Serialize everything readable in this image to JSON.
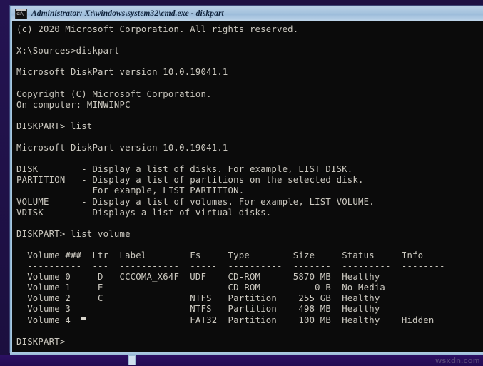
{
  "window": {
    "title": "Administrator: X:\\windows\\system32\\cmd.exe - diskpart",
    "icon": "cmd-icon",
    "colors": {
      "titlebar_top": "#b7cfe6",
      "titlebar_bottom": "#bdd4e9",
      "titlebar_text": "#10233c",
      "console_bg": "#0b0b0b",
      "console_fg": "#ccc9c0",
      "frame": "#8fb6d4",
      "desktop_bg": "#1a0f3d",
      "taskbar_bg": "#2c1063"
    }
  },
  "console": {
    "lines": [
      "(c) 2020 Microsoft Corporation. All rights reserved.",
      "",
      "X:\\Sources>diskpart",
      "",
      "Microsoft DiskPart version 10.0.19041.1",
      "",
      "Copyright (C) Microsoft Corporation.",
      "On computer: MINWINPC",
      "",
      "DISKPART> list",
      "",
      "Microsoft DiskPart version 10.0.19041.1",
      "",
      "DISK        - Display a list of disks. For example, LIST DISK.",
      "PARTITION   - Display a list of partitions on the selected disk.",
      "              For example, LIST PARTITION.",
      "VOLUME      - Display a list of volumes. For example, LIST VOLUME.",
      "VDISK       - Displays a list of virtual disks.",
      "",
      "DISKPART> list volume",
      "",
      "  Volume ###  Ltr  Label        Fs     Type        Size     Status     Info",
      "  ----------  ---  -----------  -----  ----------  -------  ---------  --------",
      "  Volume 0     D   CCCOMA_X64F  UDF    CD-ROM      5870 MB  Healthy",
      "  Volume 1     E                       CD-ROM          0 B  No Media",
      "  Volume 2     C                NTFS   Partition    255 GB  Healthy",
      "  Volume 3                      NTFS   Partition    498 MB  Healthy",
      "  Volume 4                      FAT32  Partition    100 MB  Healthy    Hidden",
      "",
      "DISKPART>"
    ],
    "prompt": "DISKPART>",
    "cursor": "block-cursor",
    "commands_entered": [
      "diskpart",
      "list",
      "list volume"
    ],
    "diskpart_version": "10.0.19041.1",
    "computer_name": "MINWINPC",
    "copyright": "Copyright (C) Microsoft Corporation.",
    "help_entries": [
      {
        "command": "DISK",
        "description": "Display a list of disks. For example, LIST DISK."
      },
      {
        "command": "PARTITION",
        "description": "Display a list of partitions on the selected disk. For example, LIST PARTITION."
      },
      {
        "command": "VOLUME",
        "description": "Display a list of volumes. For example, LIST VOLUME."
      },
      {
        "command": "VDISK",
        "description": "Displays a list of virtual disks."
      }
    ],
    "volume_table": {
      "headers": [
        "Volume ###",
        "Ltr",
        "Label",
        "Fs",
        "Type",
        "Size",
        "Status",
        "Info"
      ],
      "rows": [
        {
          "volume": "Volume 0",
          "ltr": "D",
          "label": "CCCOMA_X64F",
          "fs": "UDF",
          "type": "CD-ROM",
          "size": "5870 MB",
          "status": "Healthy",
          "info": ""
        },
        {
          "volume": "Volume 1",
          "ltr": "E",
          "label": "",
          "fs": "",
          "type": "CD-ROM",
          "size": "0 B",
          "status": "No Media",
          "info": ""
        },
        {
          "volume": "Volume 2",
          "ltr": "C",
          "label": "",
          "fs": "NTFS",
          "type": "Partition",
          "size": "255 GB",
          "status": "Healthy",
          "info": ""
        },
        {
          "volume": "Volume 3",
          "ltr": "",
          "label": "",
          "fs": "NTFS",
          "type": "Partition",
          "size": "498 MB",
          "status": "Healthy",
          "info": ""
        },
        {
          "volume": "Volume 4",
          "ltr": "",
          "label": "",
          "fs": "FAT32",
          "type": "Partition",
          "size": "100 MB",
          "status": "Healthy",
          "info": "Hidden"
        }
      ]
    }
  },
  "taskbar": {
    "item_label": ""
  },
  "watermark": {
    "text": "wsxdn.com"
  }
}
